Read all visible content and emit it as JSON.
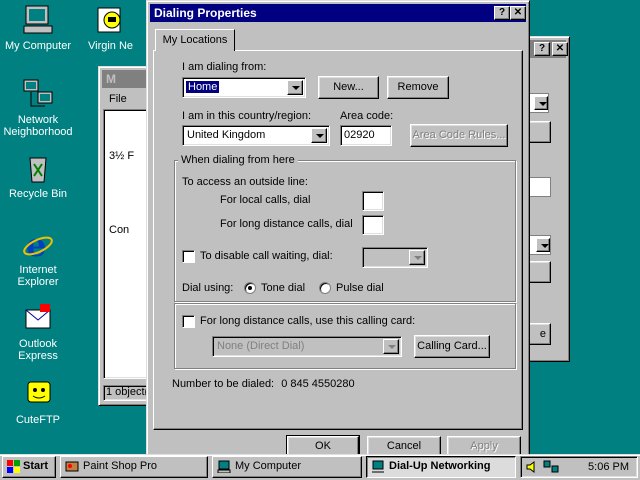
{
  "desktop": {
    "icons": [
      {
        "label": "My Computer",
        "icon": "my-computer-icon"
      },
      {
        "label": "Virgin Ne",
        "icon": "virgin-net-icon"
      },
      {
        "label": "Network Neighborhood",
        "icon": "network-neighborhood-icon"
      },
      {
        "label": "Recycle Bin",
        "icon": "recycle-bin-icon"
      },
      {
        "label": "Internet Explorer",
        "icon": "internet-explorer-icon"
      },
      {
        "label": "Outlook Express",
        "icon": "outlook-express-icon"
      },
      {
        "label": "CuteFTP",
        "icon": "cuteftp-icon"
      }
    ]
  },
  "bg_window": {
    "title_fragment": "M",
    "menu_file": "File",
    "item1": "3½ F",
    "item2": "Con",
    "status": "1 object(s"
  },
  "dialup_window": {
    "button_fragment": "e"
  },
  "dialog": {
    "title": "Dialing Properties",
    "tab": "My Locations",
    "dialing_from_label": "I am dialing from:",
    "dialing_from_value": "Home",
    "new_button": "New...",
    "remove_button": "Remove",
    "country_label": "I am in this country/region:",
    "country_value": "United Kingdom",
    "area_code_label": "Area code:",
    "area_code_value": "02920",
    "area_code_rules_button": "Area Code Rules...",
    "group_label": "When dialing from here",
    "outside_line_label": "To access an outside line:",
    "local_calls_label": "For local calls, dial",
    "local_calls_value": "",
    "long_distance_label": "For long distance calls, dial",
    "long_distance_value": "",
    "call_waiting_label": "To disable call waiting, dial:",
    "call_waiting_checked": false,
    "dial_using_label": "Dial using:",
    "tone_label": "Tone dial",
    "pulse_label": "Pulse dial",
    "dial_mode": "tone",
    "calling_card_check_label": "For long distance calls, use this calling card:",
    "calling_card_checked": false,
    "calling_card_value": "None (Direct Dial)",
    "calling_card_button": "Calling Card...",
    "number_to_dial_label": "Number to be dialed:",
    "number_to_dial_value": "0 845 4550280",
    "ok_button": "OK",
    "cancel_button": "Cancel",
    "apply_button": "Apply"
  },
  "taskbar": {
    "start": "Start",
    "tasks": [
      {
        "label": "Paint Shop Pro",
        "icon": "paint-shop-pro-icon",
        "active": false
      },
      {
        "label": "My Computer",
        "icon": "my-computer-icon",
        "active": false
      },
      {
        "label": "Dial-Up Networking",
        "icon": "dial-up-networking-icon",
        "active": true
      }
    ],
    "clock": "5:06 PM"
  },
  "colors": {
    "desktop": "#008080",
    "active_title": "#000080",
    "face": "#c0c0c0"
  }
}
